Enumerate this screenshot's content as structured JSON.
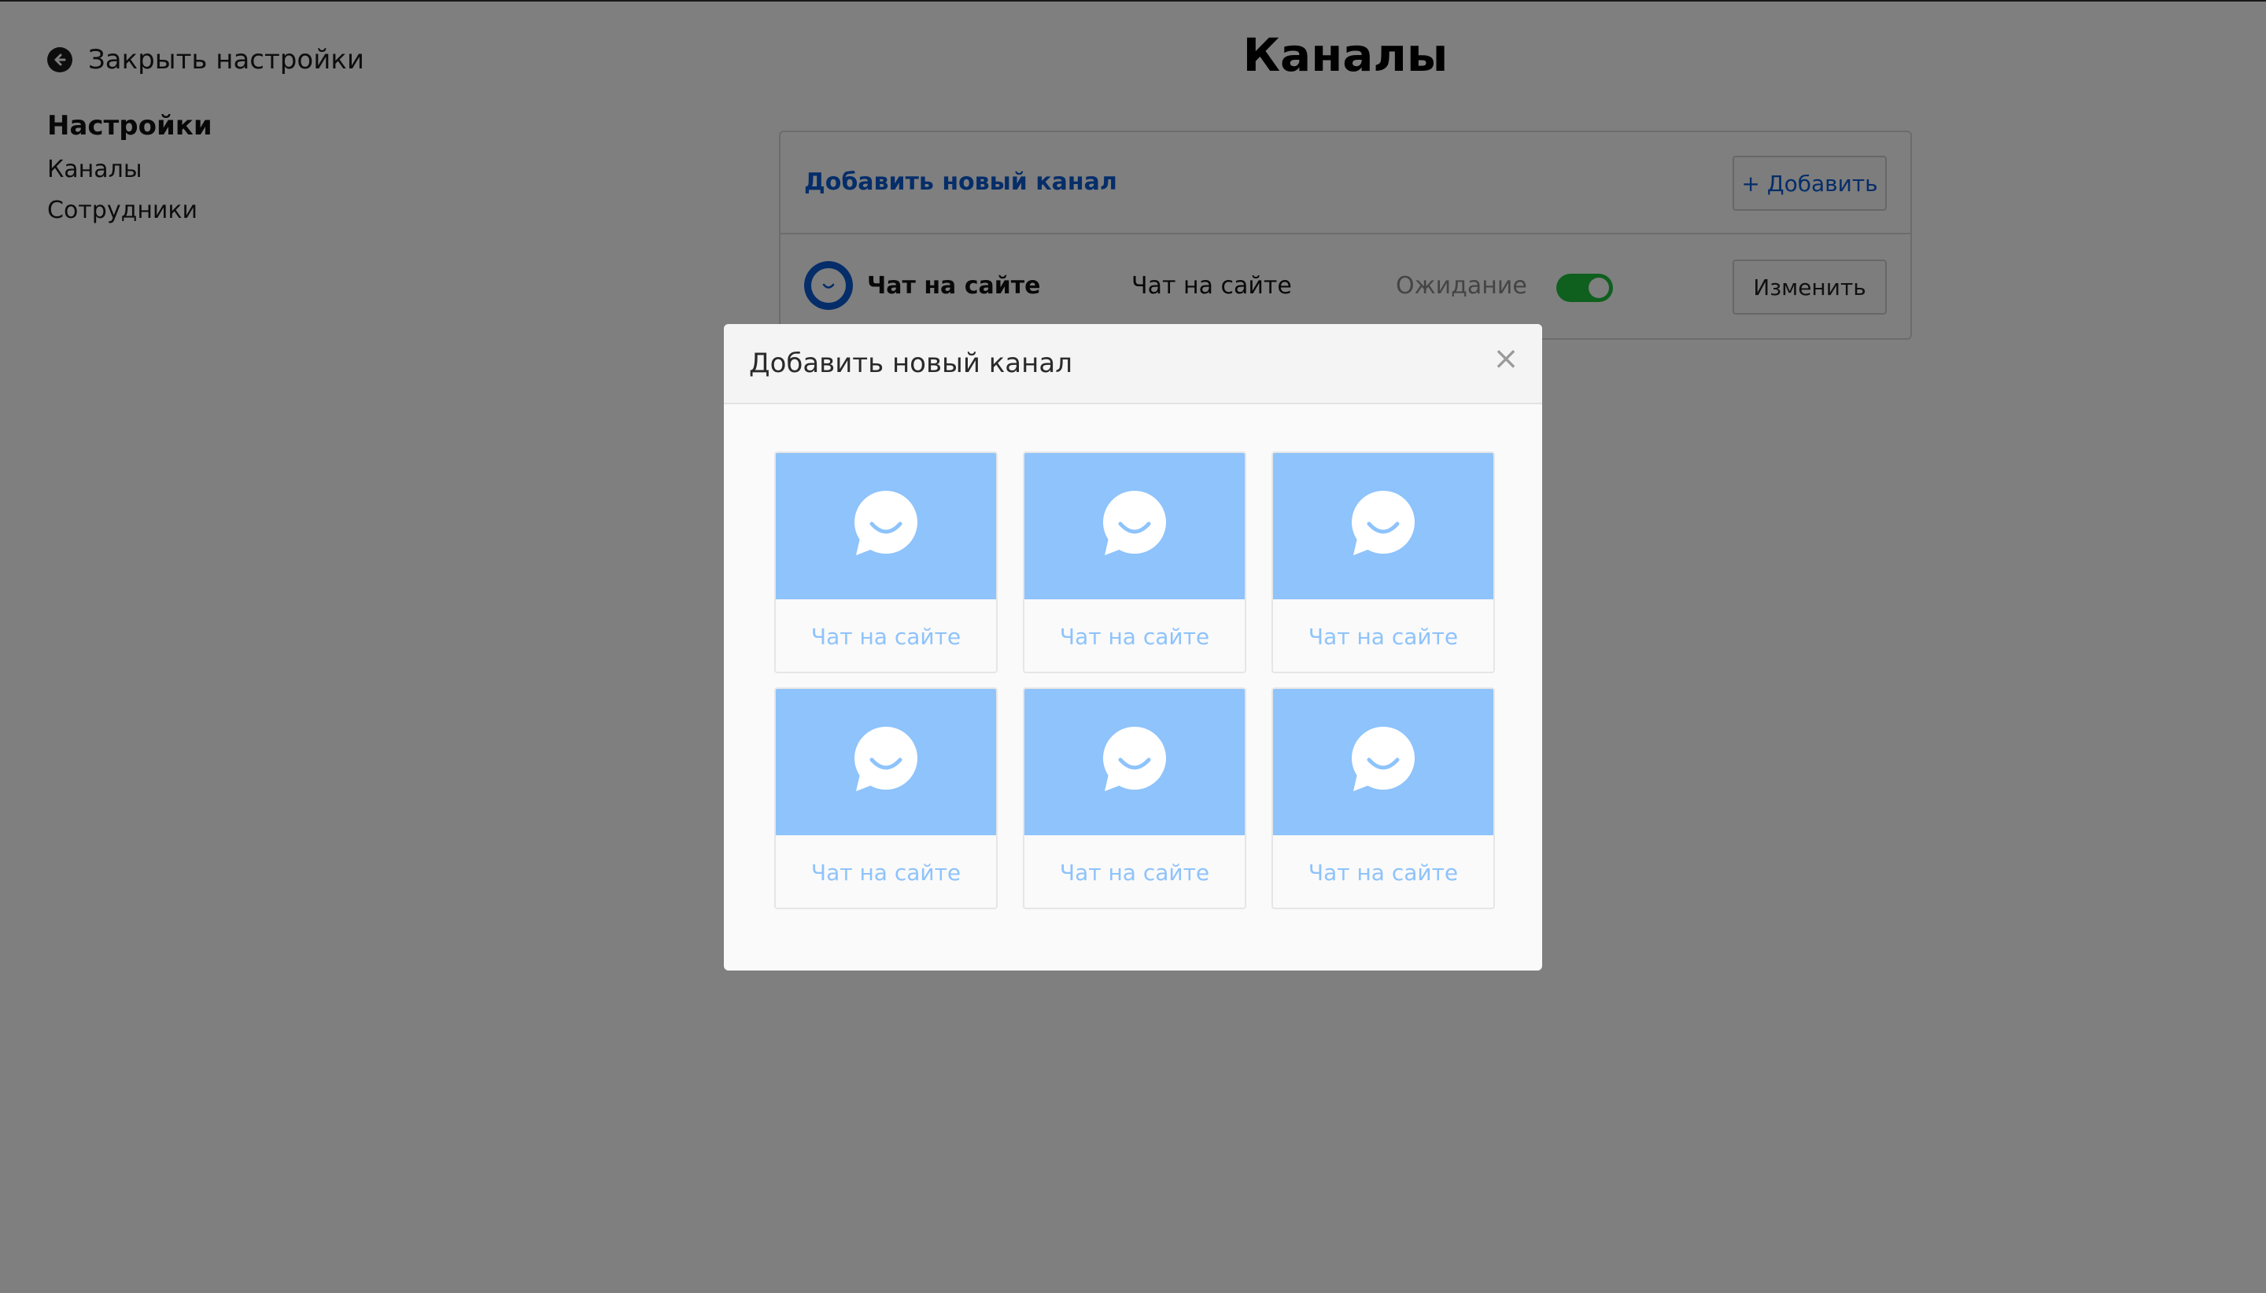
{
  "sidebar": {
    "close_label": "Закрыть настройки",
    "heading": "Настройки",
    "items": [
      {
        "label": "Каналы"
      },
      {
        "label": "Сотрудники"
      }
    ]
  },
  "main": {
    "title": "Каналы",
    "add_link": "Добавить новый канал",
    "add_button": "+ Добавить",
    "channel_row": {
      "name": "Чат на сайте",
      "type": "Чат на сайте",
      "status": "Ожидание",
      "enabled": true,
      "edit_button": "Изменить"
    }
  },
  "modal": {
    "title": "Добавить новый канал",
    "close_glyph": "×",
    "cards": [
      {
        "label": "Чат на сайте"
      },
      {
        "label": "Чат на сайте"
      },
      {
        "label": "Чат на сайте"
      },
      {
        "label": "Чат на сайте"
      },
      {
        "label": "Чат на сайте"
      },
      {
        "label": "Чат на сайте"
      }
    ]
  },
  "icons": {
    "back": "arrow-left-circle-icon",
    "chat": "chat-bubble-smile-icon"
  },
  "colors": {
    "accent": "#0b5bd3",
    "card_blue": "#8ec3fb",
    "toggle_on": "#1fbf3c"
  }
}
